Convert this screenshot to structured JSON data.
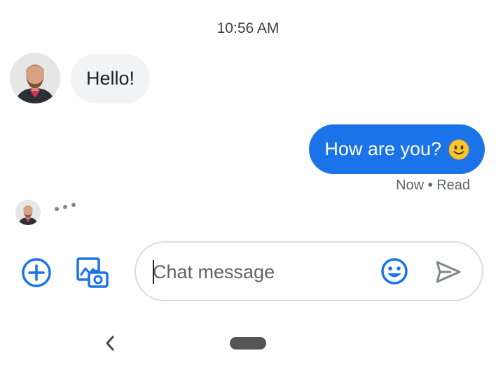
{
  "timestamp": "10:56 AM",
  "messages": {
    "incoming": {
      "text": "Hello!",
      "avatar": "contact-avatar"
    },
    "outgoing": {
      "text": "How are you?",
      "emoji": "slightly-smiling-face",
      "receipt": "Now • Read"
    }
  },
  "typing_indicator": {
    "avatar": "contact-avatar",
    "icon": "typing-dots"
  },
  "compose": {
    "placeholder": "Chat message",
    "value": "",
    "buttons": {
      "attach": "add-circle-icon",
      "gallery": "gallery-camera-icon",
      "emoji": "emoji-icon",
      "send": "send-icon"
    }
  },
  "colors": {
    "accent": "#1a73e8",
    "incoming_bubble": "#f1f3f4",
    "outgoing_bubble": "#1a73e8",
    "compose_border": "#dadce0",
    "send_disabled": "#80868b"
  },
  "nav": {
    "back": "back-chevron-icon",
    "home": "home-pill"
  }
}
